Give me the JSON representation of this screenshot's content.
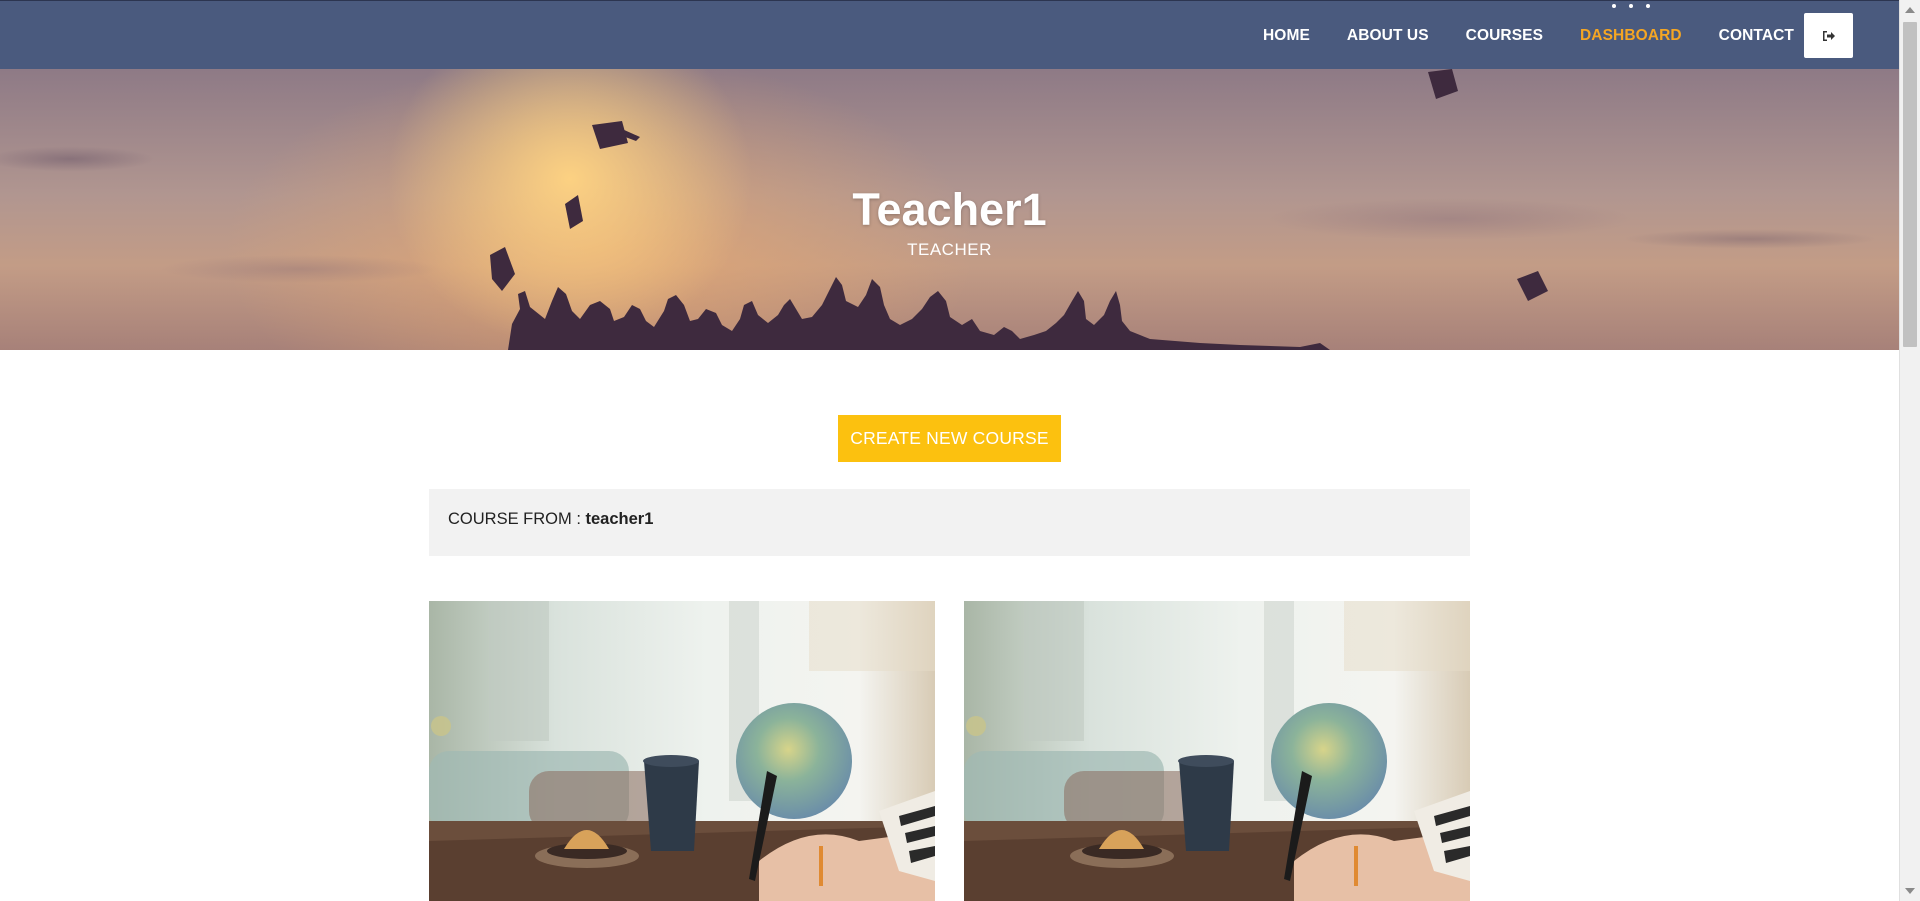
{
  "nav": {
    "items": [
      {
        "label": "HOME",
        "active": false
      },
      {
        "label": "ABOUT US",
        "active": false
      },
      {
        "label": "COURSES",
        "active": false
      },
      {
        "label": "DASHBOARD",
        "active": true
      },
      {
        "label": "CONTACT",
        "active": false
      }
    ],
    "logout_icon": "sign-out-icon",
    "active_color": "#f5a623",
    "bar_color": "#4a5a7e"
  },
  "hero": {
    "name": "Teacher1",
    "role": "TEACHER"
  },
  "actions": {
    "create_label": "CREATE NEW COURSE",
    "button_color": "#fcc10f"
  },
  "course_section": {
    "prefix": "COURSE FROM : ",
    "owner": "teacher1"
  },
  "courses": [
    {
      "image": "desk-study-photo"
    },
    {
      "image": "desk-study-photo"
    }
  ]
}
